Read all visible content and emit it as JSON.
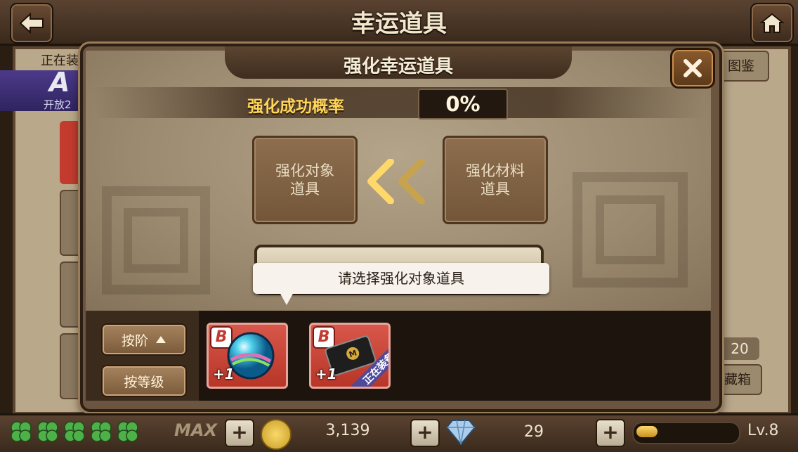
{
  "header": {
    "title": "幸运道具",
    "back_icon": "back-arrow-icon",
    "home_icon": "home-icon"
  },
  "background_page": {
    "equipping_label": "正在装",
    "banner_letter": "A",
    "banner_open_text": "开放2",
    "right_button_top": "图鉴",
    "right_count": "20",
    "right_button_bottom": "藏箱"
  },
  "modal": {
    "title": "强化幸运道具",
    "close_icon": "close-x-icon",
    "rate_label": "强化成功概率",
    "rate_value": "0%",
    "target_slot_label": "强化对象\n道具",
    "material_slot_label": "强化材料\n道具",
    "arrow_icon": "double-chevron-left-icon",
    "tooltip_text": "请选择强化对象道具",
    "sort_buttons": [
      {
        "label": "按阶",
        "icon": "triangle-up-icon"
      },
      {
        "label": "按等级"
      }
    ],
    "items": [
      {
        "grade": "B",
        "level": "+1",
        "icon": "orb-icon"
      },
      {
        "grade": "B",
        "level": "+1",
        "icon": "card-icon",
        "ribbon": "正在装备"
      }
    ]
  },
  "status_bar": {
    "clovers": 5,
    "max_label": "MAX",
    "gold": "3,139",
    "gems": "29",
    "level": "Lv.8",
    "xp_fraction": 0.2,
    "colors": {
      "accent": "#ffd55a",
      "card_red": "#c23b2e"
    }
  }
}
